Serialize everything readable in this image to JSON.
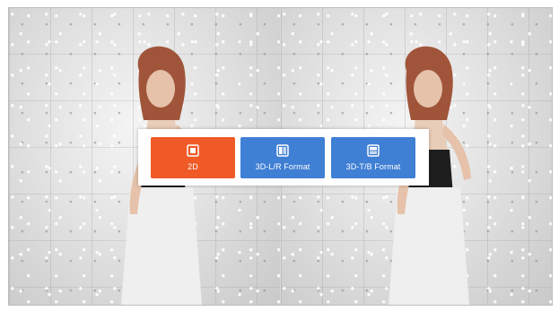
{
  "colors": {
    "active": "#f05a26",
    "inactive": "#3f7fd4"
  },
  "mode_selector": {
    "options": [
      {
        "label": "2D",
        "icon": "2d-mode-icon",
        "active": true
      },
      {
        "label": "3D-L/R Format",
        "icon": "side-by-side-icon",
        "active": false
      },
      {
        "label": "3D-T/B Format",
        "icon": "top-bottom-icon",
        "active": false
      }
    ]
  }
}
